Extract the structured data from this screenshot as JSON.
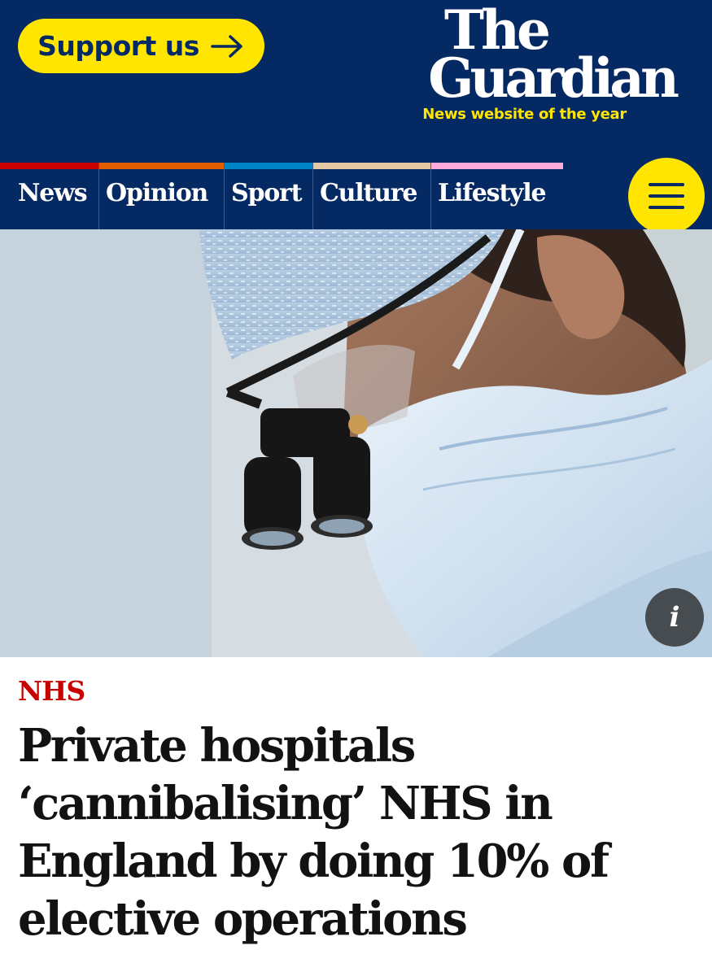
{
  "header": {
    "support_label": "Support us",
    "logo_line1": "The",
    "logo_line2": "Guardian",
    "tagline": "News website of the year"
  },
  "nav": {
    "items": [
      {
        "label": "News",
        "color": "#c70000"
      },
      {
        "label": "Opinion",
        "color": "#e05e00"
      },
      {
        "label": "Sport",
        "color": "#0084c6"
      },
      {
        "label": "Culture",
        "color": "#a1845c"
      },
      {
        "label": "Lifestyle",
        "color": "#bb3b80"
      }
    ],
    "menu_icon": "hamburger-icon"
  },
  "hero": {
    "info_glyph": "i"
  },
  "article": {
    "kicker": "NHS",
    "headline": "Private hospitals ‘cannibalising’ NHS in England by doing 10% of elective operations"
  },
  "colors": {
    "brand": "#052962",
    "accent": "#ffe500",
    "kicker": "#c70000"
  }
}
